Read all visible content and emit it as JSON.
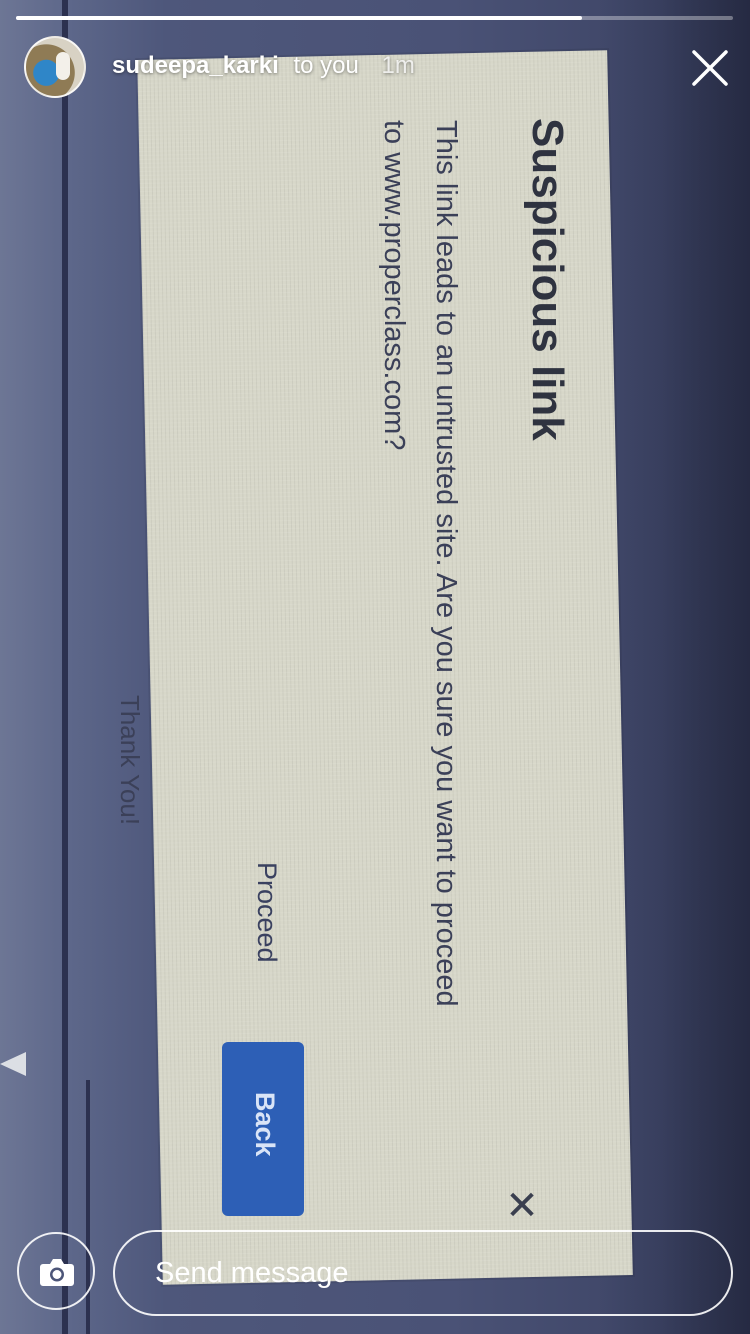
{
  "story": {
    "progress_fraction": 0.79,
    "username": "sudeepa_karki",
    "recipient_text": "to you",
    "time_ago": "1m"
  },
  "dialog": {
    "title": "Suspicious link",
    "body_line1": "This link leads to an untrusted site. Are you sure you want to proceed",
    "body_line2": "to www.properclass.com?",
    "proceed_label": "Proceed",
    "back_label": "Back",
    "close_glyph": "✕"
  },
  "background": {
    "thank_you": "Thank You!"
  },
  "footer": {
    "message_placeholder": "Send message"
  },
  "icons": {
    "close": "close-icon",
    "camera": "camera-icon"
  }
}
